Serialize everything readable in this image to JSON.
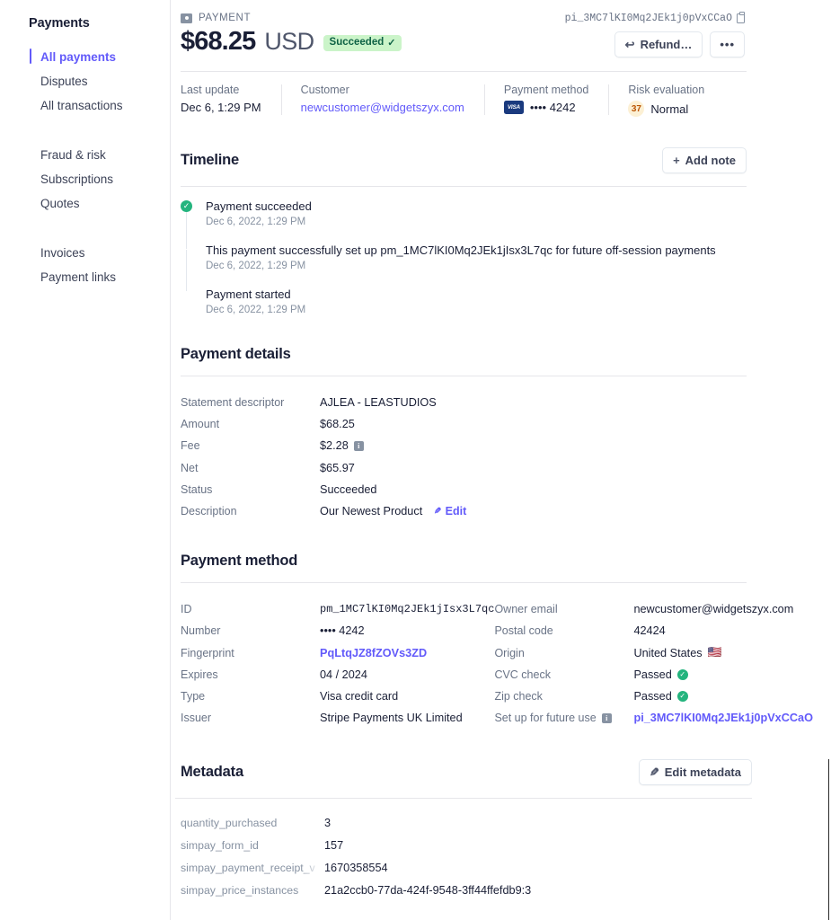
{
  "sidebar": {
    "title": "Payments",
    "groups": [
      {
        "items": [
          {
            "label": "All payments",
            "active": true
          },
          {
            "label": "Disputes",
            "active": false
          },
          {
            "label": "All transactions",
            "active": false
          }
        ]
      },
      {
        "items": [
          {
            "label": "Fraud & risk",
            "active": false
          },
          {
            "label": "Subscriptions",
            "active": false
          },
          {
            "label": "Quotes",
            "active": false
          }
        ]
      },
      {
        "items": [
          {
            "label": "Invoices",
            "active": false
          },
          {
            "label": "Payment links",
            "active": false
          }
        ]
      }
    ]
  },
  "header": {
    "eyebrow": "PAYMENT",
    "amount": "$68.25",
    "currency": "USD",
    "status_chip": "Succeeded",
    "status_tick": "✓",
    "payment_id": "pi_3MC7lKI0Mq2JEk1j0pVxCCaO",
    "refund_label": "Refund…",
    "refund_glyph": "↩",
    "more_label": "•••"
  },
  "summary": [
    {
      "label": "Last update",
      "value": "Dec 6, 1:29 PM",
      "kind": "text"
    },
    {
      "label": "Customer",
      "value": "newcustomer@widgetszyx.com",
      "kind": "link"
    },
    {
      "label": "Payment method",
      "value": "•••• 4242",
      "kind": "card",
      "brand": "VISA"
    },
    {
      "label": "Risk evaluation",
      "value": "Normal",
      "kind": "risk",
      "score": "37"
    }
  ],
  "timeline": {
    "title": "Timeline",
    "add_note_label": "Add note",
    "add_note_glyph": "+",
    "events": [
      {
        "icon": "check-circle-icon",
        "text": "Payment succeeded",
        "date": "Dec 6, 2022, 1:29 PM"
      },
      {
        "icon": "card-icon",
        "text": "This payment successfully set up pm_1MC7lKI0Mq2JEk1jIsx3L7qc for future off-session payments",
        "date": "Dec 6, 2022, 1:29 PM"
      },
      {
        "icon": "payment-icon",
        "text": "Payment started",
        "date": "Dec 6, 2022, 1:29 PM"
      }
    ]
  },
  "payment_details": {
    "title": "Payment details",
    "rows": [
      {
        "key": "Statement descriptor",
        "value": "AJLEA - LEASTUDIOS"
      },
      {
        "key": "Amount",
        "value": "$68.25"
      },
      {
        "key": "Fee",
        "value": "$2.28",
        "info": true
      },
      {
        "key": "Net",
        "value": "$65.97"
      },
      {
        "key": "Status",
        "value": "Succeeded"
      },
      {
        "key": "Description",
        "value": "Our Newest Product",
        "edit_label": "Edit"
      }
    ]
  },
  "payment_method": {
    "title": "Payment method",
    "left_rows": [
      {
        "key": "ID",
        "value": "pm_1MC7lKI0Mq2JEk1jIsx3L7qc",
        "mono": true
      },
      {
        "key": "Number",
        "value": "•••• 4242"
      },
      {
        "key": "Fingerprint",
        "value": "PqLtqJZ8fZOVs3ZD",
        "link": true
      },
      {
        "key": "Expires",
        "value": "04 / 2024"
      },
      {
        "key": "Type",
        "value": "Visa credit card"
      },
      {
        "key": "Issuer",
        "value": "Stripe Payments UK Limited"
      }
    ],
    "right_rows": [
      {
        "key": "Owner email",
        "value": "newcustomer@widgetszyx.com"
      },
      {
        "key": "Postal code",
        "value": "42424"
      },
      {
        "key": "Origin",
        "value": "United States",
        "flag": "🇺🇸"
      },
      {
        "key": "CVC check",
        "value": "Passed",
        "ok": true
      },
      {
        "key": "Zip check",
        "value": "Passed",
        "ok": true
      },
      {
        "key": "Set up for future use",
        "value": "pi_3MC7lKI0Mq2JEk1j0pVxCCaO",
        "link": true,
        "info": true
      }
    ]
  },
  "metadata": {
    "title": "Metadata",
    "edit_label": "Edit metadata",
    "edit_glyph": "✎",
    "rows": [
      {
        "key": "quantity_purchased",
        "value": "3",
        "truncated": false
      },
      {
        "key": "simpay_form_id",
        "value": "157",
        "truncated": false
      },
      {
        "key": "simpay_payment_receipt_v",
        "value": "1670358554",
        "truncated": true
      },
      {
        "key": "simpay_price_instances",
        "value": "21a2ccb0-77da-424f-9548-3ff44ffefdb9:3",
        "truncated": false
      }
    ]
  },
  "colors": {
    "accent": "#625afa",
    "success": "#24b47e",
    "success_bg": "#cbf4c9",
    "success_text": "#0e6245",
    "risk_bg": "#fcf0d4",
    "risk_text": "#bb5504",
    "muted": "#697386"
  }
}
